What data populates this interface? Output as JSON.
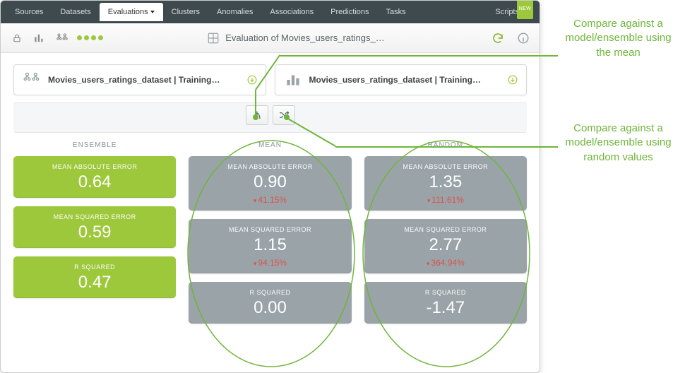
{
  "nav": {
    "items": [
      "Sources",
      "Datasets",
      "Evaluations",
      "Clusters",
      "Anomalies",
      "Associations",
      "Predictions",
      "Tasks"
    ],
    "active_index": 2,
    "scripts": "Scripts",
    "new_badge": "NEW"
  },
  "toolbar": {
    "title": "Evaluation of Movies_users_ratings_…"
  },
  "datasets": {
    "left": "Movies_users_ratings_dataset | Training…",
    "right": "Movies_users_ratings_dataset | Training…"
  },
  "columns": {
    "ensemble": {
      "title": "ENSEMBLE",
      "mae": {
        "label": "MEAN ABSOLUTE ERROR",
        "value": "0.64"
      },
      "mse": {
        "label": "MEAN SQUARED ERROR",
        "value": "0.59"
      },
      "r2": {
        "label": "R SQUARED",
        "value": "0.47"
      }
    },
    "mean": {
      "title": "MEAN",
      "mae": {
        "label": "MEAN ABSOLUTE ERROR",
        "value": "0.90",
        "delta": "41.15%"
      },
      "mse": {
        "label": "MEAN SQUARED ERROR",
        "value": "1.15",
        "delta": "94.15%"
      },
      "r2": {
        "label": "R SQUARED",
        "value": "0.00"
      }
    },
    "random": {
      "title": "RANDOM",
      "mae": {
        "label": "MEAN ABSOLUTE ERROR",
        "value": "1.35",
        "delta": "111.61%"
      },
      "mse": {
        "label": "MEAN SQUARED ERROR",
        "value": "2.77",
        "delta": "364.94%"
      },
      "r2": {
        "label": "R SQUARED",
        "value": "-1.47"
      }
    }
  },
  "annotations": {
    "mean": "Compare against a model/ensemble using the mean",
    "random": "Compare against a model/ensemble using random values"
  }
}
